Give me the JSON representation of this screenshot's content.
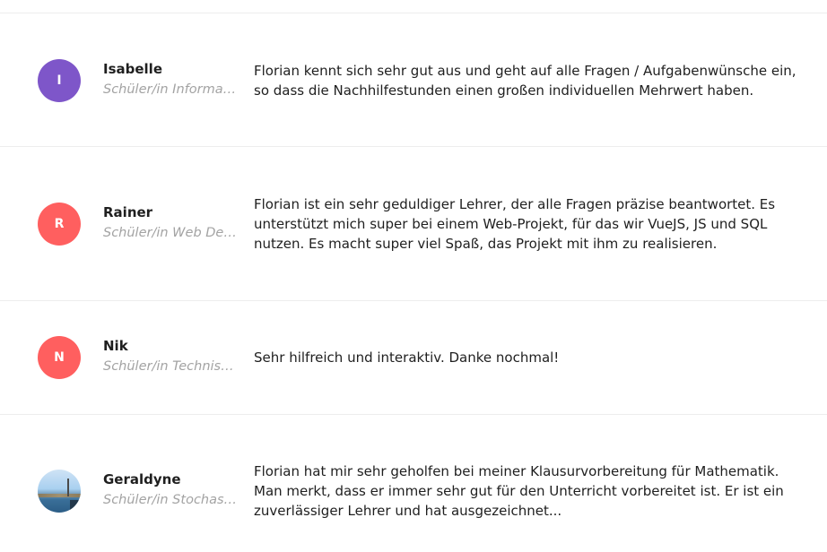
{
  "reviews": [
    {
      "name": "Isabelle",
      "initial": "I",
      "avatar_color": "#7e56c9",
      "subject": "Schüler/in Informatik",
      "text": "Florian kennt sich sehr gut aus und geht auf alle Fragen / Aufgabenwünsche ein, so dass die Nachhilfestunden einen großen individuellen Mehrwert haben."
    },
    {
      "name": "Rainer",
      "initial": "R",
      "avatar_color": "#ff5f5f",
      "subject": "Schüler/in Web Development",
      "text": "Florian ist ein sehr geduldiger Lehrer, der alle Fragen präzise beantwortet. Es unterstützt mich super bei einem Web-Projekt, für das wir VueJS, JS und SQL nutzen. Es macht super viel Spaß, das Projekt mit ihm zu realisieren."
    },
    {
      "name": "Nik",
      "initial": "N",
      "avatar_color": "#ff5f5f",
      "subject": "Schüler/in Technische Informatik",
      "text": "Sehr hilfreich und interaktiv. Danke nochmal!"
    },
    {
      "name": "Geraldyne",
      "avatar_icon": "lake-photo",
      "subject": "Schüler/in Stochastik",
      "text": "Florian hat mir sehr geholfen bei meiner Klausurvorbereitung für Mathematik. Man merkt, dass er immer sehr gut für den Unterricht vorbereitet ist. Er ist ein zuverlässiger Lehrer und hat ausgezeichnet..."
    }
  ]
}
